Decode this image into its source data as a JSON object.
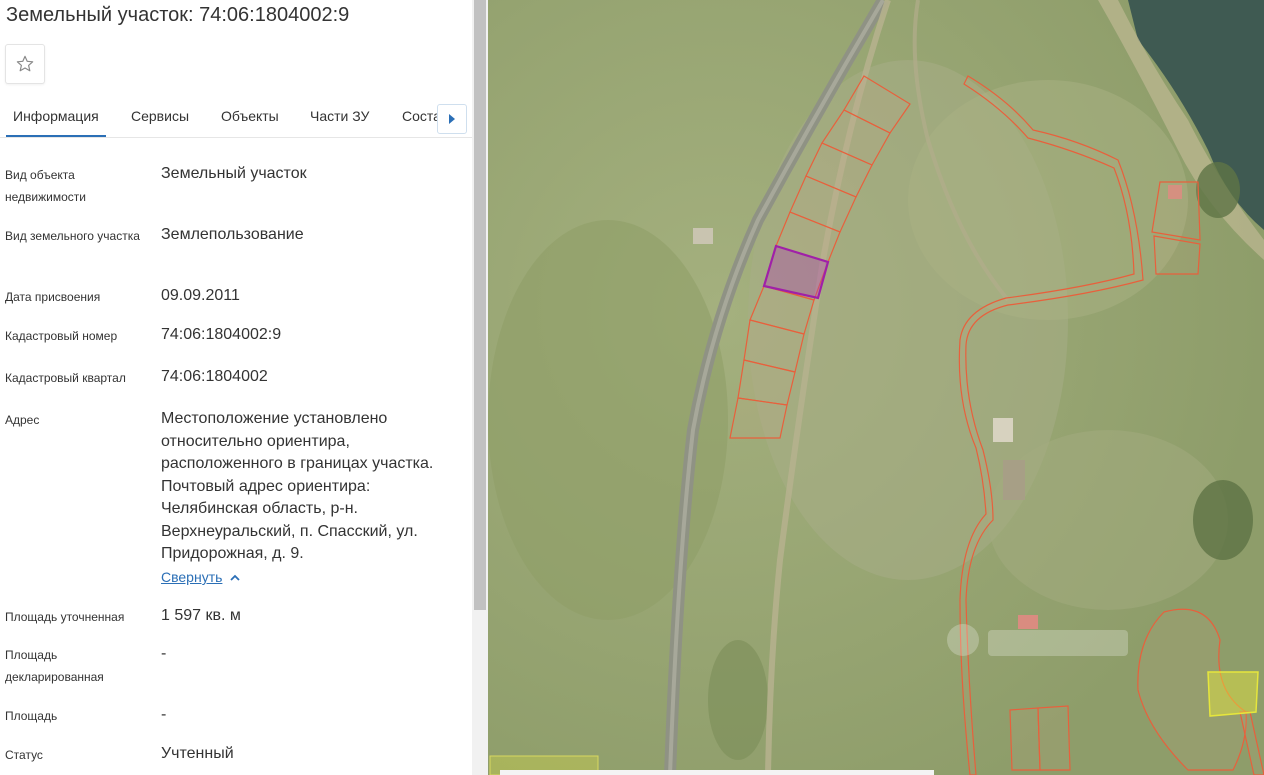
{
  "header": {
    "title": "Земельный участок: 74:06:1804002:9"
  },
  "tabs": [
    {
      "label": "Информация",
      "active": true
    },
    {
      "label": "Сервисы",
      "active": false
    },
    {
      "label": "Объекты",
      "active": false
    },
    {
      "label": "Части ЗУ",
      "active": false
    },
    {
      "label": "Соста",
      "active": false
    }
  ],
  "info": {
    "object_type_label": "Вид объекта недвижимости",
    "object_type_value": "Земельный участок",
    "land_type_label": "Вид земельного участка",
    "land_type_value": "Землепользование",
    "date_label": "Дата присвоения",
    "date_value": "09.09.2011",
    "cadastral_number_label": "Кадастровый номер",
    "cadastral_number_value": "74:06:1804002:9",
    "cadastral_quarter_label": "Кадастровый квартал",
    "cadastral_quarter_value": "74:06:1804002",
    "address_label": "Адрес",
    "address_value": "Местоположение установлено относительно ориентира, расположенного в границах участка. Почтовый адрес ориентира: Челябинская область, р-н. Верхнеуральский, п. Спасский, ул. Придорожная, д. 9.",
    "collapse_label": "Свернуть",
    "area_refined_label": "Площадь уточненная",
    "area_refined_value": "1 597 кв. м",
    "area_declared_label": "Площадь декларированная",
    "area_declared_value": "-",
    "area_label": "Площадь",
    "area_value": "-",
    "status_label": "Статус",
    "status_value": "Учтенный"
  },
  "icons": {
    "favorite": "star-outline-icon",
    "next": "caret-right-icon",
    "collapse": "chevron-up-icon"
  },
  "colors": {
    "accent": "#2b6fb6",
    "parcel_border": "#e8603c",
    "selected_parcel": "#a020a8",
    "highlight_parcel": "#e6e63c"
  }
}
